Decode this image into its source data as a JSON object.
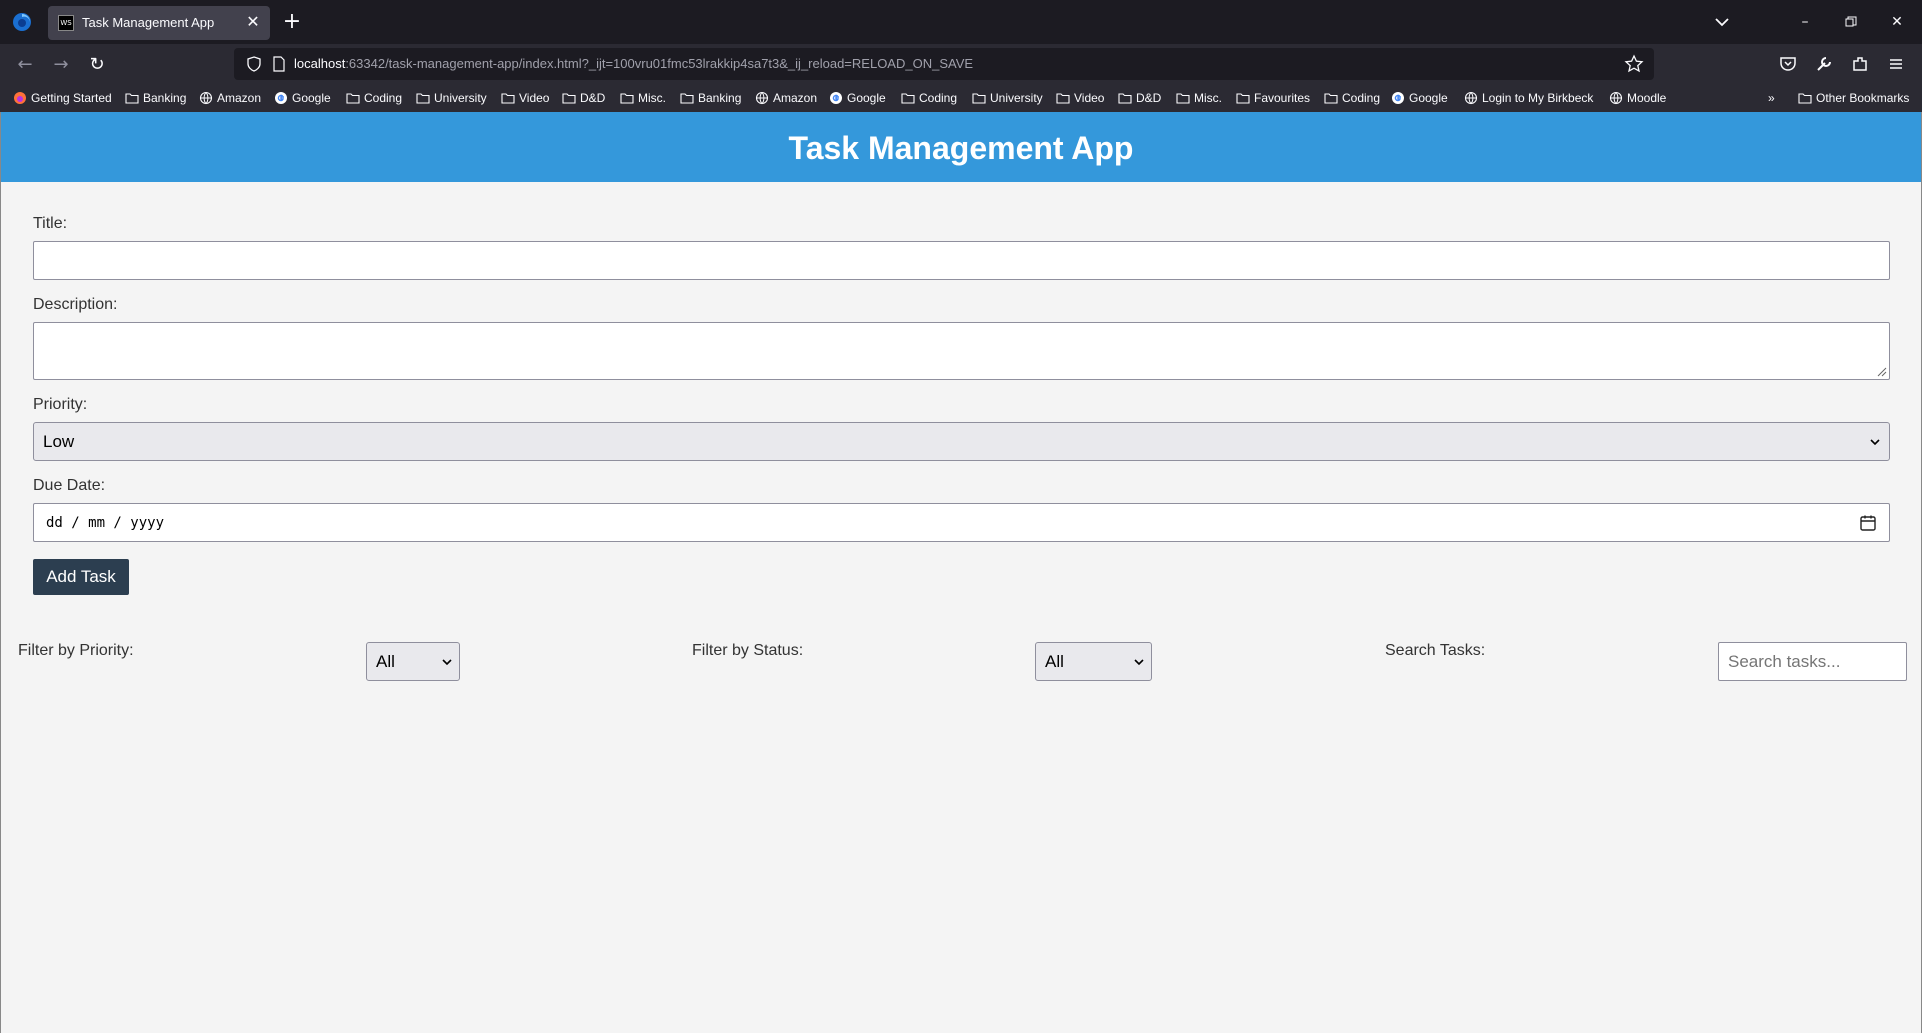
{
  "browser": {
    "tab_title": "Task Management App",
    "tab_favicon_text": "WS",
    "url_host": "localhost",
    "url_rest": ":63342/task-management-app/index.html?_ijt=100vru01fmc53lrakkip4sa7t3&_ij_reload=RELOAD_ON_SAVE",
    "bookmarks": [
      {
        "label": "Getting Started",
        "icon": "firefox-icon"
      },
      {
        "label": "Banking",
        "icon": "folder-icon"
      },
      {
        "label": "Amazon",
        "icon": "globe-icon"
      },
      {
        "label": "Google",
        "icon": "google-icon"
      },
      {
        "label": "Coding",
        "icon": "folder-icon"
      },
      {
        "label": "University",
        "icon": "folder-icon"
      },
      {
        "label": "Video",
        "icon": "folder-icon"
      },
      {
        "label": "D&D",
        "icon": "folder-icon"
      },
      {
        "label": "Misc.",
        "icon": "folder-icon"
      },
      {
        "label": "Banking",
        "icon": "folder-icon"
      },
      {
        "label": "Amazon",
        "icon": "globe-icon"
      },
      {
        "label": "Google",
        "icon": "google-icon"
      },
      {
        "label": "Coding",
        "icon": "folder-icon"
      },
      {
        "label": "University",
        "icon": "folder-icon"
      },
      {
        "label": "Video",
        "icon": "folder-icon"
      },
      {
        "label": "D&D",
        "icon": "folder-icon"
      },
      {
        "label": "Misc.",
        "icon": "folder-icon"
      },
      {
        "label": "Favourites",
        "icon": "folder-icon"
      },
      {
        "label": "Coding",
        "icon": "folder-icon"
      },
      {
        "label": "Google",
        "icon": "google-icon"
      },
      {
        "label": "Login to My Birkbeck",
        "icon": "globe-icon"
      },
      {
        "label": "Moodle",
        "icon": "globe-icon"
      }
    ],
    "other_bookmarks": "Other Bookmarks"
  },
  "app": {
    "title": "Task Management App",
    "accent_color": "#3498db",
    "button_color": "#2c3e50"
  },
  "form": {
    "title_label": "Title:",
    "title_value": "",
    "description_label": "Description:",
    "description_value": "",
    "priority_label": "Priority:",
    "priority_value": "Low",
    "due_date_label": "Due Date:",
    "due_date_placeholder": "dd / mm / yyyy",
    "add_button": "Add Task"
  },
  "filters": {
    "priority_label": "Filter by Priority:",
    "priority_value": "All",
    "status_label": "Filter by Status:",
    "status_value": "All",
    "search_label": "Search Tasks:",
    "search_placeholder": "Search tasks..."
  }
}
